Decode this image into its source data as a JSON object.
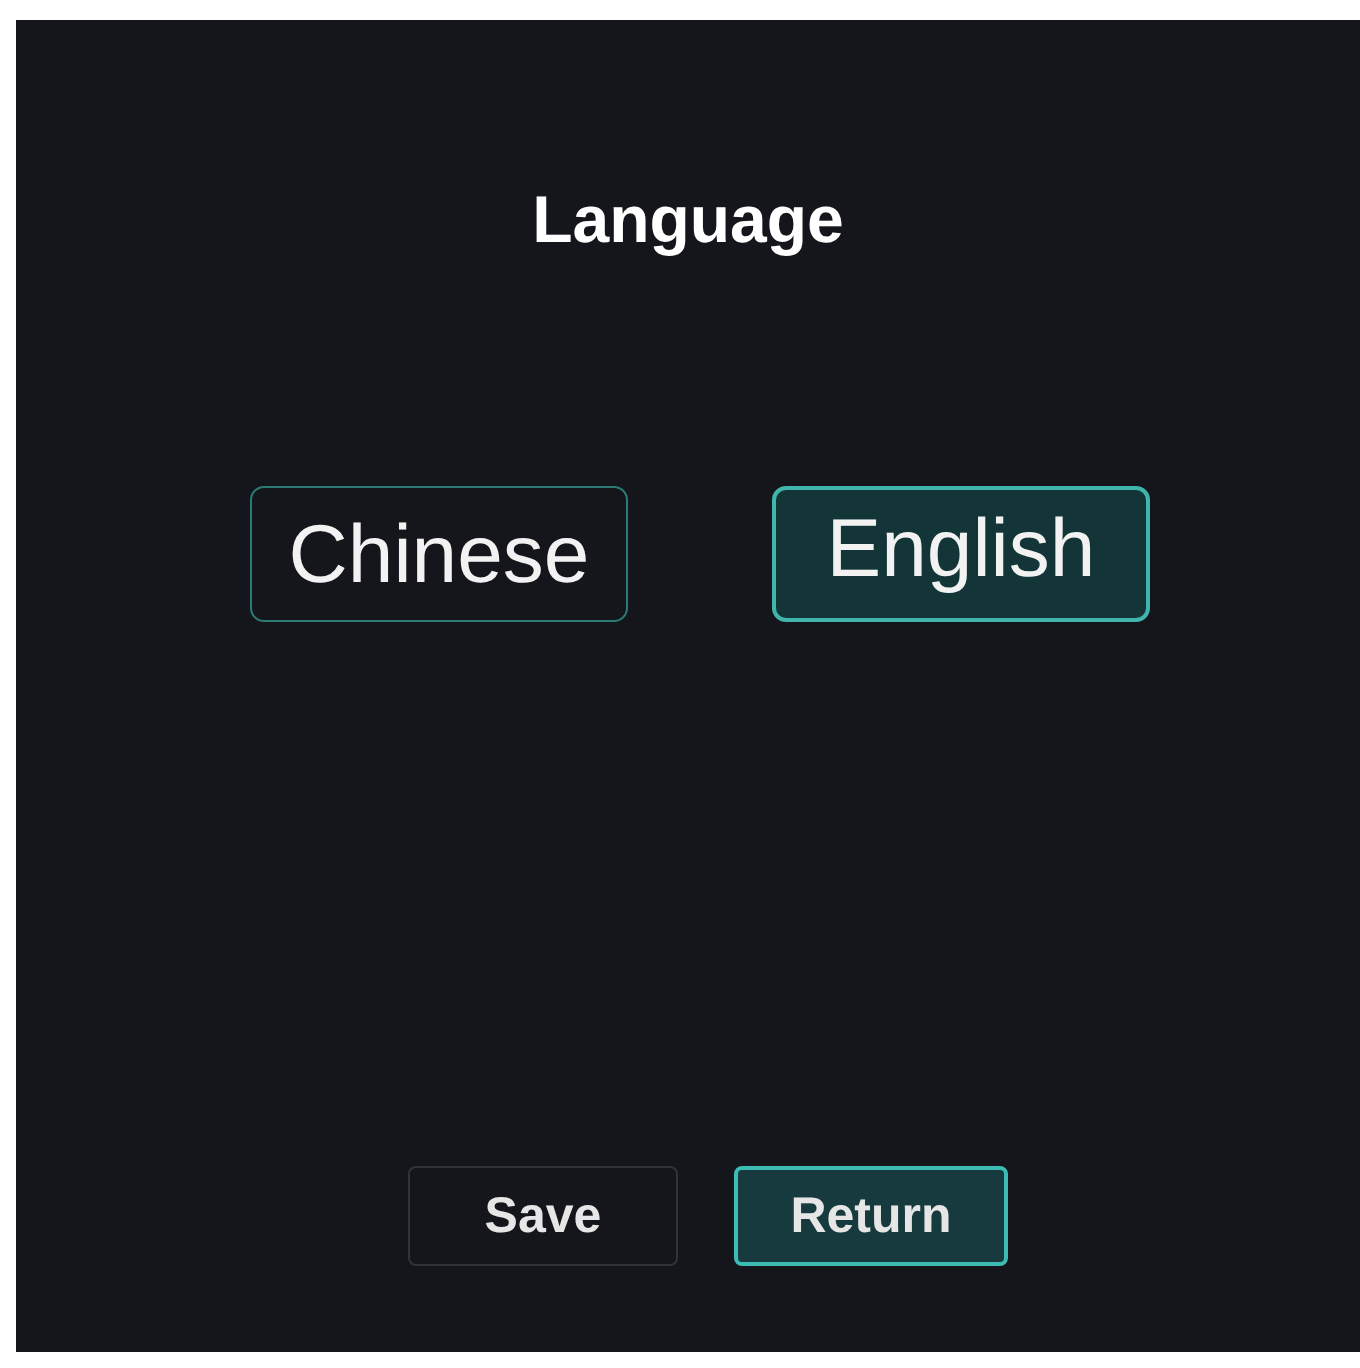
{
  "title": "Language",
  "options": [
    {
      "label": "Chinese",
      "selected": false
    },
    {
      "label": "English",
      "selected": true
    }
  ],
  "buttons": [
    {
      "label": "Save",
      "selected": false
    },
    {
      "label": "Return",
      "selected": true
    }
  ]
}
